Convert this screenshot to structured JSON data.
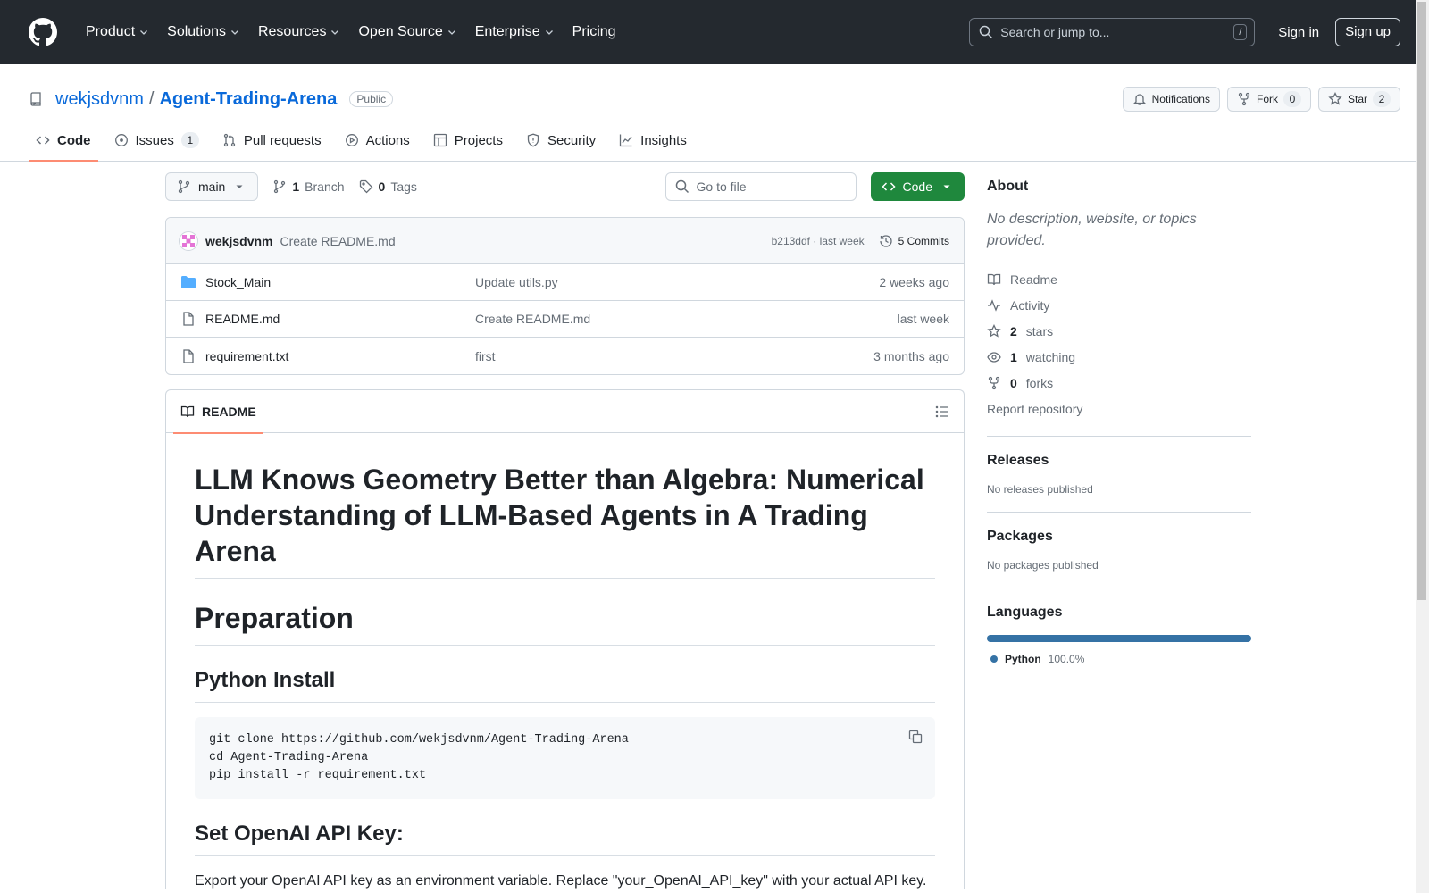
{
  "header": {
    "nav": [
      {
        "label": "Product",
        "has_menu": true
      },
      {
        "label": "Solutions",
        "has_menu": true
      },
      {
        "label": "Resources",
        "has_menu": true
      },
      {
        "label": "Open Source",
        "has_menu": true
      },
      {
        "label": "Enterprise",
        "has_menu": true
      },
      {
        "label": "Pricing",
        "has_menu": false
      }
    ],
    "search_placeholder": "Search or jump to...",
    "search_key": "/",
    "sign_in": "Sign in",
    "sign_up": "Sign up"
  },
  "repo": {
    "owner": "wekjsdvnm",
    "separator": "/",
    "name": "Agent-Trading-Arena",
    "visibility": "Public",
    "notifications_label": "Notifications",
    "fork_label": "Fork",
    "fork_count": "0",
    "star_label": "Star",
    "star_count": "2"
  },
  "tabs": [
    {
      "label": "Code",
      "icon": "code-icon",
      "active": true,
      "count": ""
    },
    {
      "label": "Issues",
      "icon": "issue-icon",
      "active": false,
      "count": "1"
    },
    {
      "label": "Pull requests",
      "icon": "pull-request-icon",
      "active": false,
      "count": ""
    },
    {
      "label": "Actions",
      "icon": "play-icon",
      "active": false,
      "count": ""
    },
    {
      "label": "Projects",
      "icon": "table-icon",
      "active": false,
      "count": ""
    },
    {
      "label": "Security",
      "icon": "shield-icon",
      "active": false,
      "count": ""
    },
    {
      "label": "Insights",
      "icon": "graph-icon",
      "active": false,
      "count": ""
    }
  ],
  "toolbar": {
    "branch": "main",
    "branch_count": "1",
    "branch_label": "Branch",
    "tag_count": "0",
    "tag_label": "Tags",
    "goto_placeholder": "Go to file",
    "code_button": "Code"
  },
  "latest_commit": {
    "author": "wekjsdvnm",
    "message": "Create README.md",
    "hash_time": "b213ddf · last week",
    "commits": "5 Commits"
  },
  "files": [
    {
      "name": "Stock_Main",
      "type": "folder",
      "commit": "Update utils.py",
      "time": "2 weeks ago"
    },
    {
      "name": "README.md",
      "type": "file",
      "commit": "Create README.md",
      "time": "last week"
    },
    {
      "name": "requirement.txt",
      "type": "file",
      "commit": "first",
      "time": "3 months ago"
    }
  ],
  "readme": {
    "tab_label": "README",
    "title": "LLM Knows Geometry Better than Algebra: Numerical Understanding of LLM-Based Agents in A Trading Arena",
    "h_preparation": "Preparation",
    "h_python_install": "Python Install",
    "code_lines": [
      "git clone https://github.com/wekjsdvnm/Agent-Trading-Arena",
      "cd Agent-Trading-Arena",
      "pip install -r requirement.txt"
    ],
    "h_openai": "Set OpenAI API Key:",
    "p_openai": "Export your OpenAI API key as an environment variable. Replace \"your_OpenAI_API_key\" with your actual API key."
  },
  "sidebar": {
    "about_title": "About",
    "about_desc": "No description, website, or topics provided.",
    "links": [
      {
        "icon": "book-icon",
        "count": "",
        "label": "Readme"
      },
      {
        "icon": "pulse-icon",
        "count": "",
        "label": "Activity"
      },
      {
        "icon": "star-icon",
        "count": "2",
        "label": "stars"
      },
      {
        "icon": "eye-icon",
        "count": "1",
        "label": "watching"
      },
      {
        "icon": "fork-icon",
        "count": "0",
        "label": "forks"
      }
    ],
    "report": "Report repository",
    "releases_title": "Releases",
    "releases_text": "No releases published",
    "packages_title": "Packages",
    "packages_text": "No packages published",
    "languages_title": "Languages",
    "languages": [
      {
        "name": "Python",
        "percent": "100.0%",
        "color": "#3572A5"
      }
    ]
  },
  "colors": {
    "header_bg": "#24292f",
    "link": "#0969da",
    "primary_button": "#1f883d",
    "active_tab_underline": "#fd8c73"
  }
}
